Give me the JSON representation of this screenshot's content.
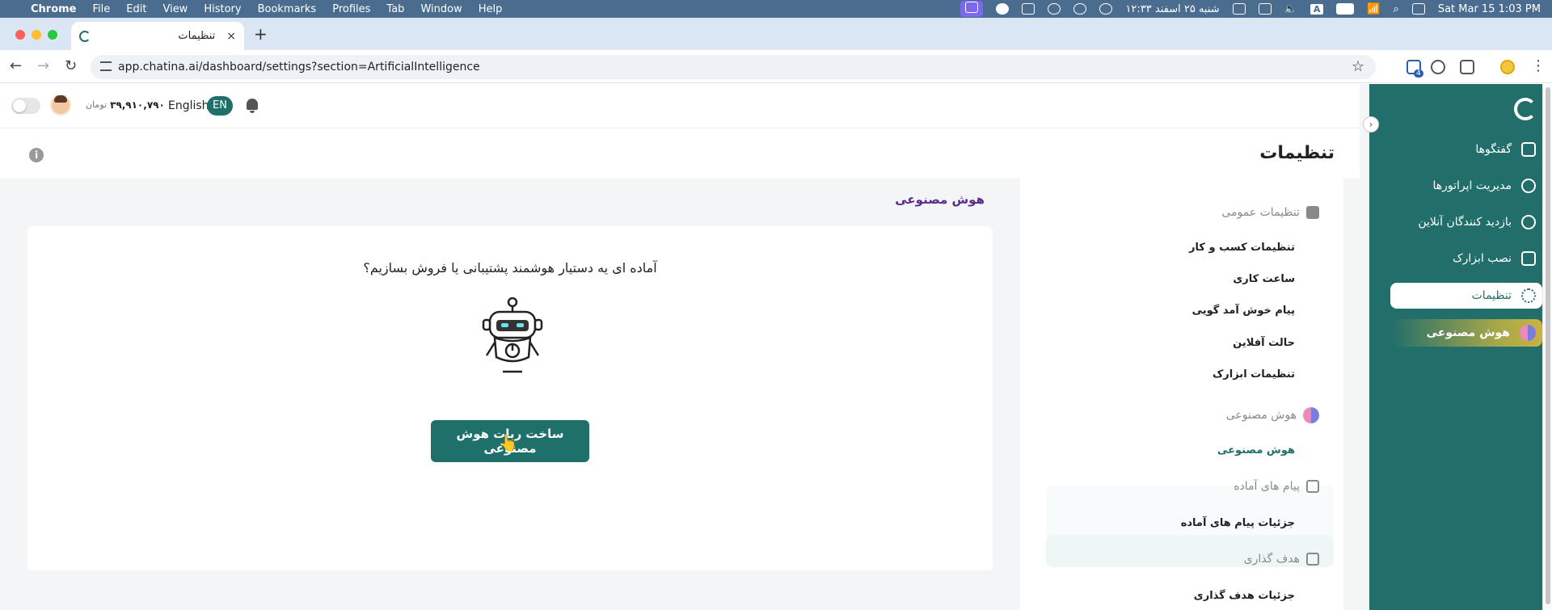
{
  "menubar": {
    "apple": "",
    "app": "Chrome",
    "menus": [
      "File",
      "Edit",
      "View",
      "History",
      "Bookmarks",
      "Profiles",
      "Tab",
      "Window",
      "Help"
    ],
    "persian_date": "شنبه ۲۵ اسفند ۱۲:۳۳",
    "keyboard_letter": "A",
    "datetime": "Sat Mar 15  1:03 PM"
  },
  "browser": {
    "tab_title": "تنظیمات",
    "tab_close": "×",
    "new_tab": "+",
    "url": "app.chatina.ai/dashboard/settings?section=ArtificialIntelligence",
    "extension_badge": "4"
  },
  "header": {
    "balance_amount": "۳۹,۹۱۰,۷۹۰",
    "balance_currency": "تومان",
    "language_label": "English",
    "language_code": "EN"
  },
  "page": {
    "title": "تنظیمات",
    "info_glyph": "i"
  },
  "sidebar": {
    "collapse_glyph": "›",
    "items": [
      {
        "label": "گفتگوها"
      },
      {
        "label": "مدیریت اپراتورها"
      },
      {
        "label": "بازدید کنندگان آنلاین"
      },
      {
        "label": "نصب ابزارک"
      },
      {
        "label": "تنظیمات"
      },
      {
        "label": "هوش مصنوعی"
      }
    ]
  },
  "settings_menu": {
    "general_section": "تنظیمات عمومی",
    "general_links": [
      "تنظیمات کسب و کار",
      "ساعت کاری",
      "پیام خوش آمد گویی",
      "حالت آفلاین",
      "تنظیمات ابزارک"
    ],
    "ai_section": "هوش مصنوعی",
    "ai_link": "هوش مصنوعی",
    "quick_section": "پیام های آماده",
    "quick_link": "جزئیات پیام های آماده",
    "goal_section": "هدف گذاری",
    "goal_link": "جزئیات هدف گذاری"
  },
  "content": {
    "heading": "هوش مصنوعی",
    "prompt": "آماده ای یه دستیار هوشمند پشتیبانی یا فروش بسازیم؟",
    "button_label": "ساخت ربات هوش مصنوعی"
  },
  "colors": {
    "primary": "#1f6f6a",
    "sidebar": "#226e6a",
    "heading_purple": "#5b2a8c",
    "menubar": "#4a6d8f"
  }
}
